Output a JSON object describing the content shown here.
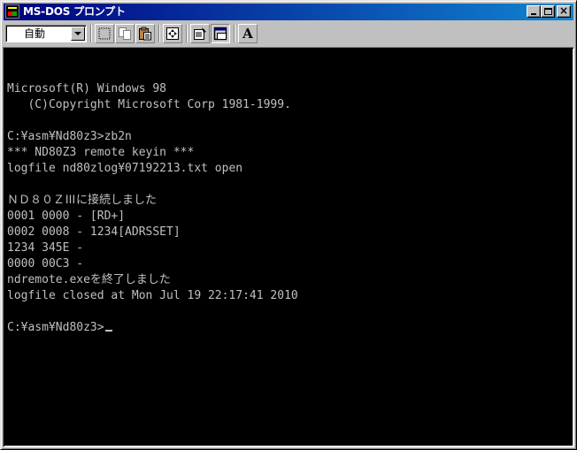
{
  "window": {
    "title": "MS-DOS プロンプト",
    "icon": "ms-dos-icon",
    "buttons": {
      "minimize": "minimize-icon",
      "maximize": "maximize-icon",
      "close": "×"
    }
  },
  "toolbar": {
    "font_size_value": "自動",
    "buttons": [
      {
        "name": "mark-button",
        "icon": "mark-icon"
      },
      {
        "name": "copy-button",
        "icon": "copy-icon"
      },
      {
        "name": "paste-button",
        "icon": "paste-icon"
      },
      {
        "name": "fullscreen-button",
        "icon": "fullscreen-icon"
      },
      {
        "name": "properties-button",
        "icon": "properties-icon"
      },
      {
        "name": "background-button",
        "icon": "background-icon"
      },
      {
        "name": "font-button",
        "icon": "font-icon",
        "label": "A"
      }
    ]
  },
  "console": {
    "lines": [
      "",
      "",
      "Microsoft(R) Windows 98",
      "   (C)Copyright Microsoft Corp 1981-1999.",
      "",
      "C:¥asm¥Nd80z3>zb2n",
      "*** ND80Z3 remote keyin ***",
      "logfile nd80zlog¥07192213.txt open",
      "",
      "ＮＤ８０ＺⅢに接続しました",
      "0001 0000 - [RD+]",
      "0002 0008 - 1234[ADRSSET]",
      "1234 345E -",
      "0000 00C3 -",
      "ndremote.exeを終了しました",
      "logfile closed at Mon Jul 19 22:17:41 2010",
      "",
      "C:¥asm¥Nd80z3>"
    ],
    "colors": {
      "background": "#000000",
      "text": "#c0c0c0"
    }
  }
}
